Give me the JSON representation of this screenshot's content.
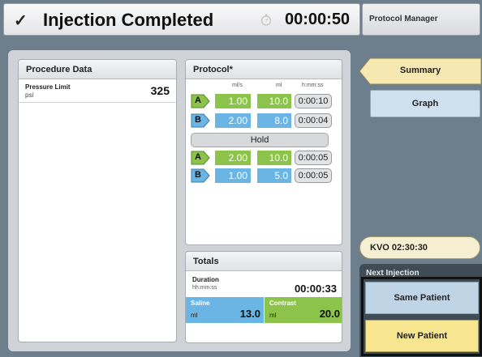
{
  "header": {
    "check_glyph": "✓",
    "title": "Injection Completed",
    "timer_icon": "timer-icon",
    "elapsed": "00:00:50",
    "side_title": "Protocol Manager"
  },
  "procedure": {
    "title": "Procedure Data",
    "pressure_label": "Pressure Limit",
    "pressure_unit": "psi",
    "pressure_value": "325"
  },
  "protocol": {
    "title": "Protocol*",
    "columns": [
      "ml/s",
      "ml",
      "h:mm:ss"
    ],
    "hold_label": "Hold",
    "phases": [
      {
        "syringe": "A",
        "rate": "1.00",
        "volume": "10.0",
        "duration": "0:00:10"
      },
      {
        "syringe": "B",
        "rate": "2.00",
        "volume": "8.0",
        "duration": "0:00:04"
      },
      {
        "syringe": "A",
        "rate": "2.00",
        "volume": "10.0",
        "duration": "0:00:05"
      },
      {
        "syringe": "B",
        "rate": "1.00",
        "volume": "5.0",
        "duration": "0:00:05"
      }
    ]
  },
  "totals": {
    "title": "Totals",
    "duration_label": "Duration",
    "duration_unit": "hh:mm:ss",
    "duration_value": "00:00:33",
    "saline_label": "Saline",
    "saline_unit": "ml",
    "saline_value": "13.0",
    "contrast_label": "Contrast",
    "contrast_unit": "ml",
    "contrast_value": "20.0"
  },
  "sidebar": {
    "summary_label": "Summary",
    "graph_label": "Graph",
    "kvo_label": "KVO 02:30:30",
    "next_label": "Next Injection",
    "same_patient_label": "Same Patient",
    "new_patient_label": "New Patient"
  },
  "colors": {
    "syringe_a": "#8cc34b",
    "syringe_b": "#6ab5e3",
    "summary_tab": "#f6e8b0",
    "new_patient": "#f8e58f"
  }
}
